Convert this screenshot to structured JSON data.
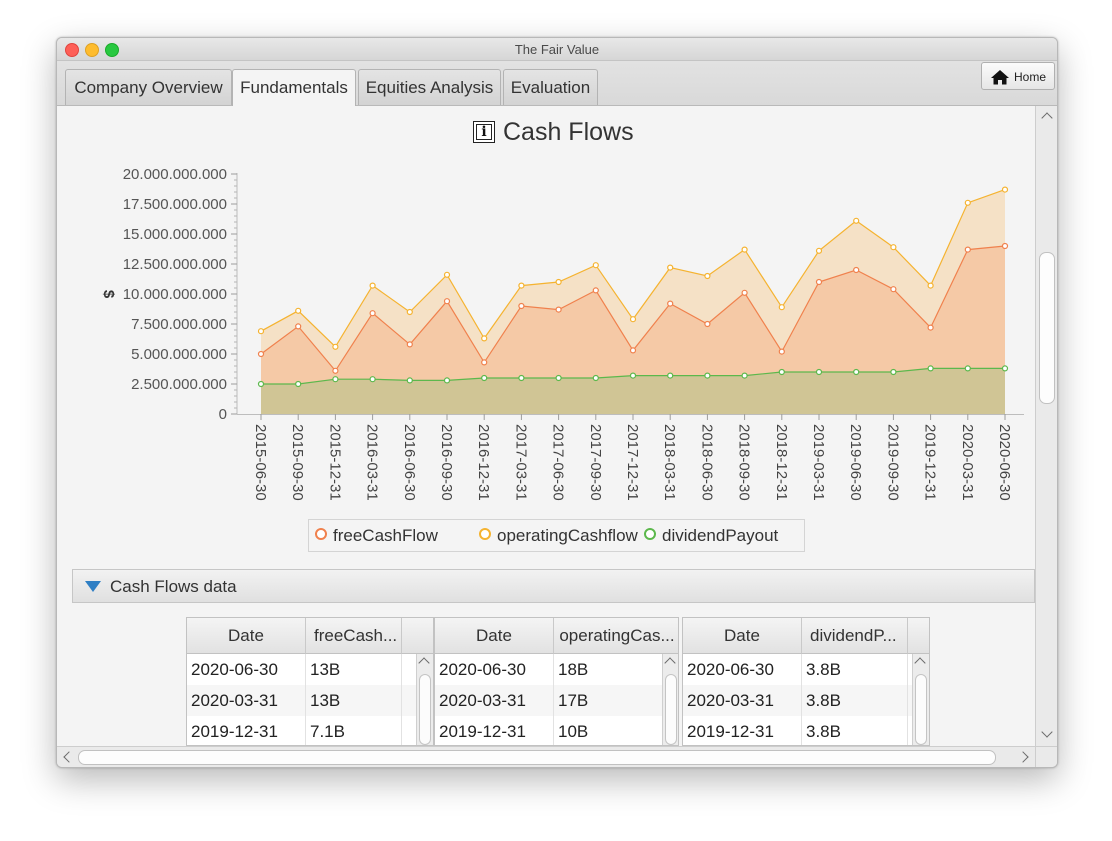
{
  "window": {
    "title": "The Fair Value"
  },
  "tabs": [
    {
      "label": "Company Overview"
    },
    {
      "label": "Fundamentals"
    },
    {
      "label": "Equities Analysis"
    },
    {
      "label": "Evaluation"
    }
  ],
  "home_button": {
    "label": "Home",
    "icon": "home-icon"
  },
  "chart_title": "Cash Flows",
  "chart_data": {
    "type": "area",
    "title": "Cash Flows",
    "xlabel": "",
    "ylabel": "$",
    "ylim": [
      0,
      20000000000
    ],
    "y_ticks": [
      "0",
      "2.500.000.000",
      "5.000.000.000",
      "7.500.000.000",
      "10.000.000.000",
      "12.500.000.000",
      "15.000.000.000",
      "17.500.000.000",
      "20.000.000.000"
    ],
    "categories": [
      "2015-06-30",
      "2015-09-30",
      "2015-12-31",
      "2016-03-31",
      "2016-06-30",
      "2016-09-30",
      "2016-12-31",
      "2017-03-31",
      "2017-06-30",
      "2017-09-30",
      "2017-12-31",
      "2018-03-31",
      "2018-06-30",
      "2018-09-30",
      "2018-12-31",
      "2019-03-31",
      "2019-06-30",
      "2019-09-30",
      "2019-12-31",
      "2020-03-31",
      "2020-06-30"
    ],
    "series": [
      {
        "name": "freeCashFlow",
        "color": "#f0814d",
        "fill": "#f5c9a6",
        "values": [
          5000000000,
          7300000000,
          3600000000,
          8400000000,
          5800000000,
          9400000000,
          4300000000,
          9000000000,
          8700000000,
          10300000000,
          5300000000,
          9200000000,
          7500000000,
          10100000000,
          5200000000,
          11000000000,
          12000000000,
          10400000000,
          7200000000,
          13700000000,
          14000000000
        ]
      },
      {
        "name": "operatingCashflow",
        "color": "#f5b330",
        "fill": "#f5e1c6",
        "values": [
          6900000000,
          8600000000,
          5600000000,
          10700000000,
          8500000000,
          11600000000,
          6300000000,
          10700000000,
          11000000000,
          12400000000,
          7900000000,
          12200000000,
          11500000000,
          13700000000,
          8900000000,
          13600000000,
          16100000000,
          13900000000,
          10700000000,
          17600000000,
          18700000000
        ]
      },
      {
        "name": "dividendPayout",
        "color": "#5cb84c",
        "fill": "#d0c595",
        "values": [
          2500000000,
          2500000000,
          2900000000,
          2900000000,
          2800000000,
          2800000000,
          3000000000,
          3000000000,
          3000000000,
          3000000000,
          3200000000,
          3200000000,
          3200000000,
          3200000000,
          3500000000,
          3500000000,
          3500000000,
          3500000000,
          3800000000,
          3800000000,
          3800000000
        ]
      }
    ],
    "grid": false,
    "legend": "bottom"
  },
  "data_pane": {
    "title": "Cash Flows data",
    "tables": [
      {
        "headers": [
          "Date",
          "freeCash..."
        ],
        "rows": [
          [
            "2020-06-30",
            "13B"
          ],
          [
            "2020-03-31",
            "13B"
          ],
          [
            "2019-12-31",
            "7.1B"
          ]
        ]
      },
      {
        "headers": [
          "Date",
          "operatingCas..."
        ],
        "rows": [
          [
            "2020-06-30",
            "18B"
          ],
          [
            "2020-03-31",
            "17B"
          ],
          [
            "2019-12-31",
            "10B"
          ]
        ]
      },
      {
        "headers": [
          "Date",
          "dividendP..."
        ],
        "rows": [
          [
            "2020-06-30",
            "3.8B"
          ],
          [
            "2020-03-31",
            "3.8B"
          ],
          [
            "2019-12-31",
            "3.8B"
          ]
        ]
      }
    ]
  }
}
